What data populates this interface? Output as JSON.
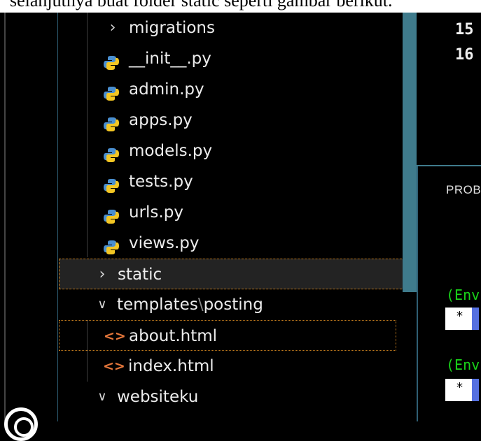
{
  "doc_strip_text": "selanjutnya buat folder static seperti gambar berikut.",
  "explorer": {
    "items": [
      {
        "label": "migrations",
        "type": "folder-collapsed",
        "icon": "chevron-right-icon"
      },
      {
        "label": "__init__.py",
        "type": "file",
        "icon": "python-file-icon"
      },
      {
        "label": "admin.py",
        "type": "file",
        "icon": "python-file-icon"
      },
      {
        "label": "apps.py",
        "type": "file",
        "icon": "python-file-icon"
      },
      {
        "label": "models.py",
        "type": "file",
        "icon": "python-file-icon"
      },
      {
        "label": "tests.py",
        "type": "file",
        "icon": "python-file-icon"
      },
      {
        "label": "urls.py",
        "type": "file",
        "icon": "python-file-icon"
      },
      {
        "label": "views.py",
        "type": "file",
        "icon": "python-file-icon"
      },
      {
        "label": "static",
        "type": "folder-collapsed",
        "icon": "chevron-right-icon"
      },
      {
        "label": "templates",
        "label_suffix": "posting",
        "type": "folder-expanded",
        "icon": "chevron-down-icon"
      },
      {
        "label": "about.html",
        "type": "file",
        "icon": "html-file-icon"
      },
      {
        "label": "index.html",
        "type": "file",
        "icon": "html-file-icon"
      },
      {
        "label": "websiteku",
        "type": "folder-expanded",
        "icon": "chevron-down-icon"
      }
    ]
  },
  "editor": {
    "line_numbers": [
      "15",
      "16"
    ]
  },
  "panel": {
    "tab_label": "PROB",
    "terminal_lines": [
      "(Env",
      "(Env"
    ],
    "prompt_glyph": "*"
  },
  "colors": {
    "python_blue": "#4a8fd0",
    "python_yellow": "#f3c623",
    "html_orange": "#e6773b",
    "highlight_border": "#c07a1d",
    "scrollbar": "#3f7b8c",
    "terminal_green": "#19d219"
  }
}
